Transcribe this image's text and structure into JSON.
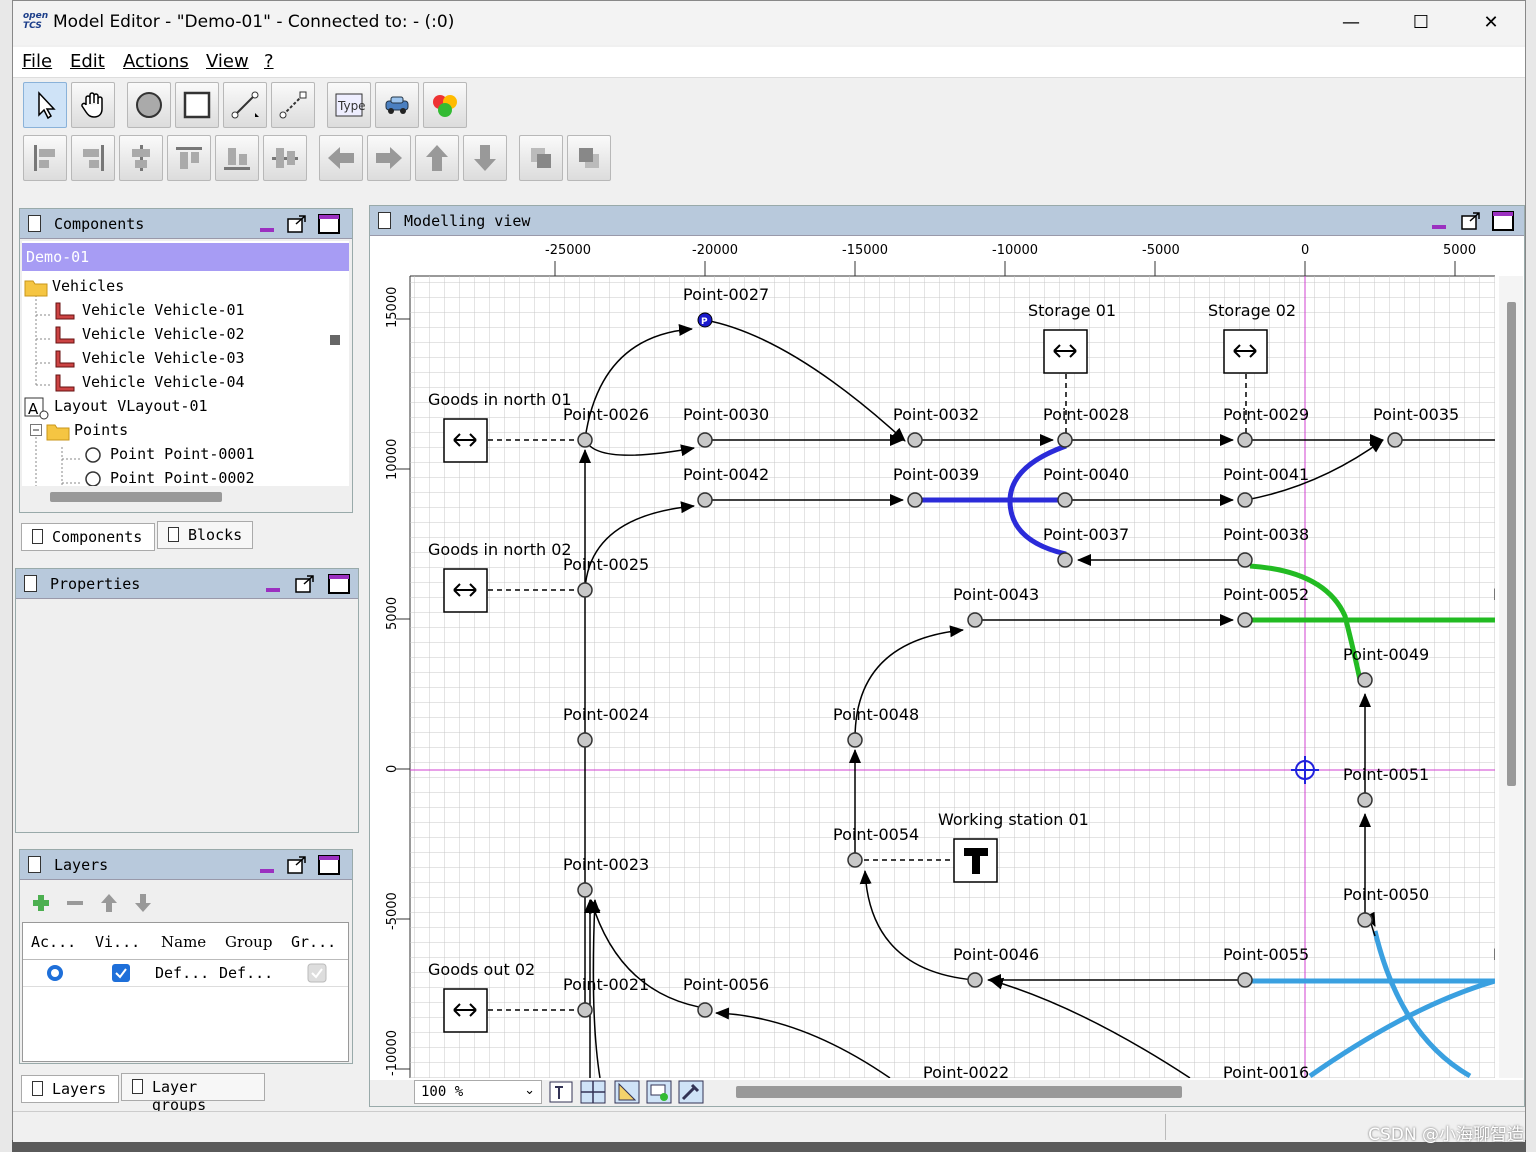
{
  "window": {
    "logo_top": "open",
    "logo_bottom": "TCS",
    "title": "Model Editor - \"Demo-01\" - Connected to: - (:0)",
    "minimize": "—",
    "maximize": "☐",
    "close": "✕"
  },
  "menu": [
    {
      "label": "File"
    },
    {
      "label": "Edit"
    },
    {
      "label": "Actions"
    },
    {
      "label": "View"
    },
    {
      "label": "?"
    }
  ],
  "toolbar1": [
    {
      "icon": "select-arrow-icon"
    },
    {
      "icon": "hand-drag-icon"
    },
    {
      "icon": "create-point-icon"
    },
    {
      "icon": "create-location-icon"
    },
    {
      "icon": "create-path-icon"
    },
    {
      "icon": "create-link-icon"
    },
    {
      "icon": "location-type-icon",
      "text": "Type"
    },
    {
      "icon": "vehicle-icon"
    },
    {
      "icon": "block-icon"
    }
  ],
  "toolbar2": [
    {
      "icon": "align-left-icon"
    },
    {
      "icon": "align-right-icon"
    },
    {
      "icon": "align-center-h-icon"
    },
    {
      "icon": "align-top-icon"
    },
    {
      "icon": "align-bottom-icon"
    },
    {
      "icon": "align-center-v-icon"
    },
    {
      "icon": "move-left-icon"
    },
    {
      "icon": "move-right-icon"
    },
    {
      "icon": "move-up-icon"
    },
    {
      "icon": "move-down-icon"
    },
    {
      "icon": "bring-to-front-icon"
    },
    {
      "icon": "send-to-back-icon"
    }
  ],
  "components_panel": {
    "title": "Components",
    "root": "Demo-01",
    "items": [
      {
        "label": "Vehicles",
        "icon": "folder-icon"
      },
      {
        "label": "Vehicle Vehicle-01",
        "icon": "vehicle-icon"
      },
      {
        "label": "Vehicle Vehicle-02",
        "icon": "vehicle-icon"
      },
      {
        "label": "Vehicle Vehicle-03",
        "icon": "vehicle-icon"
      },
      {
        "label": "Vehicle Vehicle-04",
        "icon": "vehicle-icon"
      },
      {
        "label": "Layout VLayout-01",
        "icon": "layout-icon"
      },
      {
        "label": "Points",
        "icon": "folder-icon"
      },
      {
        "label": "Point Point-0001",
        "icon": "point-icon"
      },
      {
        "label": "Point Point-0002",
        "icon": "point-icon"
      }
    ],
    "tabs": [
      "Components",
      "Blocks"
    ]
  },
  "properties_panel": {
    "title": "Properties"
  },
  "layers_panel": {
    "title": "Layers",
    "columns": [
      "Ac...",
      "Vi...",
      "Name",
      "Group",
      "Gr..."
    ],
    "row": {
      "name": "Def...",
      "group": "Def..."
    },
    "tabs": [
      "Layers",
      "Layer groups"
    ]
  },
  "modelling_view": {
    "title": "Modelling view",
    "x_ticks": [
      "-25000",
      "-20000",
      "-15000",
      "-10000",
      "-5000",
      "0",
      "5000"
    ],
    "y_ticks": [
      "15000",
      "10000",
      "5000",
      "0",
      "-5000",
      "-10000"
    ],
    "zoom": "100 %",
    "points": [
      "Point-0027",
      "Point-0026",
      "Point-0030",
      "Point-0032",
      "Point-0028",
      "Point-0029",
      "Point-0035",
      "Point-0042",
      "Point-0039",
      "Point-0040",
      "Point-0041",
      "Point-0025",
      "Point-0037",
      "Point-0038",
      "Point-0043",
      "Point-0052",
      "Point-0049",
      "Point-0024",
      "Point-0048",
      "Point-0051",
      "Point-0054",
      "Point-0023",
      "Point-0050",
      "Point-0046",
      "Point-0055",
      "Point-0021",
      "Point-0056",
      "Point-0022",
      "Point-0016"
    ],
    "locations": [
      "Storage 01",
      "Storage 02",
      "Goods in north 01",
      "Goods in north 02",
      "Working station 01",
      "Goods out 02"
    ],
    "cut_label": "Po"
  },
  "watermark": "CSDN @小海聊智造"
}
